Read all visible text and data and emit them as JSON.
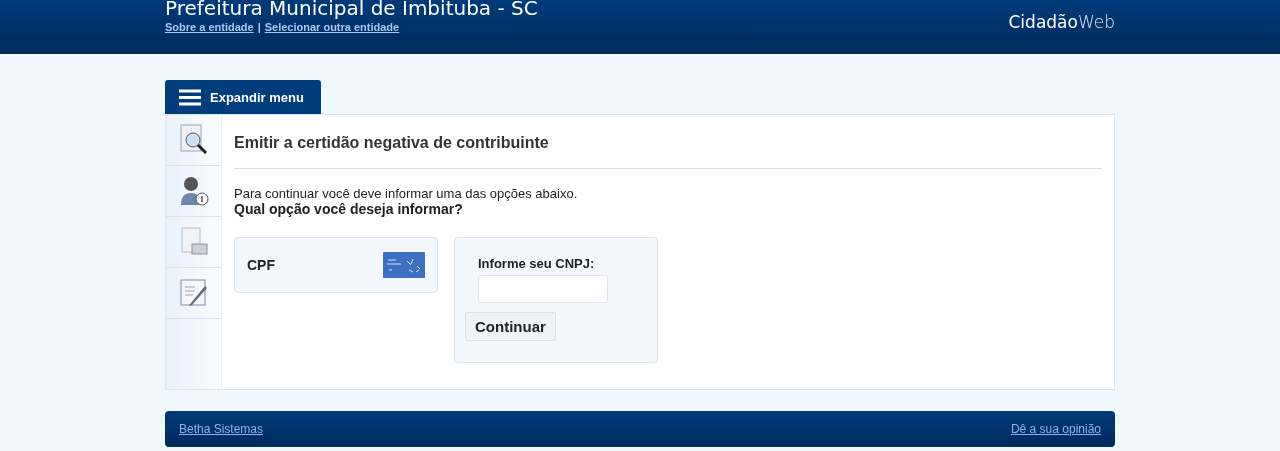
{
  "header": {
    "title": "Prefeitura Municipal de Imbituba - SC",
    "links": [
      "Sobre a entidade",
      "Selecionar outra entidade"
    ],
    "separator": "|",
    "logo": "**Cidadão**Web"
  },
  "menu_tab": {
    "label": "Expandir menu"
  },
  "sidebar": {
    "items": [
      {
        "kind": "search"
      },
      {
        "kind": "person"
      },
      {
        "kind": "printer"
      },
      {
        "kind": "edit"
      }
    ]
  },
  "content": {
    "heading": "Emitir a certidão negativa de contribuinte",
    "intro": "Para continuar você deve informar uma das opções abaixo.",
    "question": "Qual opção você deseja informar?",
    "options": [
      {
        "kind": "card",
        "label": "CPF"
      },
      {
        "kind": "form",
        "label": "Informe seu CNPJ:",
        "button": "Continuar"
      }
    ]
  },
  "footer": {
    "left_link": "Betha Sistemas",
    "right_link": "Dê a sua opinião"
  }
}
